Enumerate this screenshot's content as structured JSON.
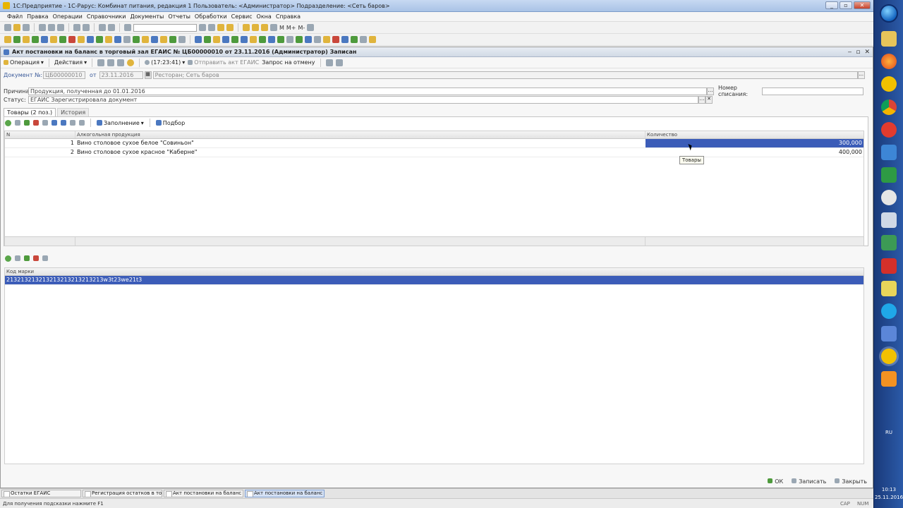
{
  "window": {
    "title": "1С:Предприятие - 1С-Рарус: Комбинат питания, редакция 1    Пользователь: <Администратор>    Подразделение: <Сеть баров>",
    "buttons": [
      "_",
      "▫",
      "✕"
    ]
  },
  "menu": [
    "Файл",
    "Правка",
    "Операции",
    "Справочники",
    "Документы",
    "Отчеты",
    "Обработки",
    "Сервис",
    "Окна",
    "Справка"
  ],
  "toolbar2_labels": [
    "М",
    "М+",
    "М-"
  ],
  "document": {
    "title": "Акт постановки на баланс в торговый зал ЕГАИС № ЦБ00000010 от 23.11.2016 (Администратор) Записан",
    "toolbar": {
      "operation": "Операция",
      "actions": "Действия",
      "time": "(17:23:41)",
      "send": "Отправить акт ЕГАИС",
      "cancel_request": "Запрос на отмену"
    },
    "number_label": "Документ №:",
    "number": "ЦБ00000010",
    "date_label": "от",
    "date": "23.11.2016",
    "org": "Ресторан; Сеть баров",
    "reason_label": "Причина:",
    "reason": "Продукция, полученная до 01.01.2016",
    "writeoff_label": "Номер списания:",
    "writeoff": "",
    "status_label": "Статус:",
    "status": "ЕГАИС Зарегистрировала документ",
    "tabs": [
      "Товары (2 поз.)",
      "История"
    ],
    "sub_toolbar": {
      "fill": "Заполнение",
      "select": "Подбор"
    },
    "goods_table": {
      "columns": [
        "N",
        "Алкогольная продукция",
        "Количество"
      ],
      "rows": [
        {
          "n": "1",
          "product": "Вино столовое сухое белое \"Совиньон\"",
          "qty": "300,000"
        },
        {
          "n": "2",
          "product": "Вино столовое сухое красное \"Каберне\"",
          "qty": "400,000"
        }
      ]
    },
    "tooltip": "Товары",
    "marks_table": {
      "columns": [
        "Код марки"
      ],
      "rows": [
        "213213213213213213213213213w3t23we21t3"
      ]
    },
    "buttons": {
      "ok": "ОК",
      "save": "Записать",
      "close": "Закрыть"
    }
  },
  "open_windows": [
    "Остатки ЕГАИС",
    "Регистрация остатков в то...",
    "Акт постановки на баланс",
    "Акт постановки на баланс ..."
  ],
  "status": {
    "hint": "Для получения подсказки нажмите F1",
    "cap": "CAP",
    "num": "NUM"
  },
  "taskbar": {
    "lang": "RU",
    "time": "10:13",
    "date": "25.11.2016"
  },
  "colors": {
    "selection": "#3b5cb8",
    "taskbar": "#1f4a96"
  }
}
